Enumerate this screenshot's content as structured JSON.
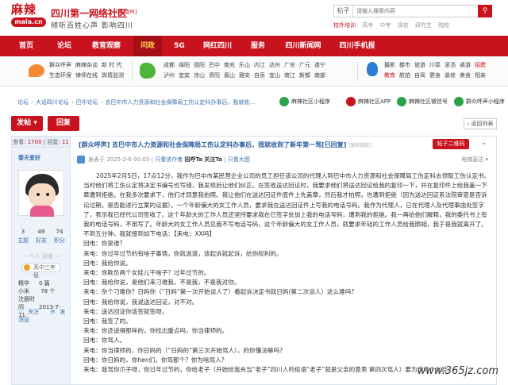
{
  "header": {
    "logo_text": "麻辣",
    "logo_sub": "mala.cn",
    "site_name": "四川第一网络社区",
    "city_tag": "[嘉南州]",
    "slogan": "倾听百姓心声 影响四川",
    "search_category": "帖子",
    "search_placeholder": "请输入搜索内容",
    "search_icon": "search-icon",
    "hot_label": "校外培训",
    "hot_links": [
      "高考",
      "中考",
      "择校",
      "研究生",
      "院校"
    ]
  },
  "nav": {
    "items": [
      "首页",
      "论坛",
      "教育观察",
      "问政",
      "5G",
      "网红四川",
      "服务",
      "四川新闻网",
      "四川手机报"
    ],
    "active_index": 3
  },
  "subnav": {
    "group1": [
      [
        "群众呼声",
        "麻辣杂谈",
        "新 时 代"
      ],
      [
        "生态环保",
        "律师在线",
        "舆情监测"
      ]
    ],
    "group2": [
      [
        "成都",
        "绵阳",
        "德阳",
        "巴中",
        "南充",
        "乐山",
        "内江",
        "达州",
        "广安",
        "广元",
        "遂宁"
      ],
      [
        "泸州",
        "宜宾",
        "凉山",
        "资阳",
        "眉山",
        "雅安",
        "自贡",
        "宜山",
        "南江",
        "新都",
        "南部"
      ]
    ],
    "group3": [
      [
        "摄影",
        "楼市",
        "旅游",
        "川菜",
        "滚汤",
        "桌游",
        "招聘"
      ],
      [
        "教育",
        "航拍",
        "自驾",
        "健身",
        "装修",
        "美食",
        "相亲"
      ]
    ],
    "highlight": [
      "招聘",
      "教育"
    ]
  },
  "breadcrumb": [
    "论坛",
    "大话四川论坛",
    "巴中论坛",
    "去巴中市人力资源和社会保障局工伤认定科办事后，我就收..."
  ],
  "mini_links": [
    "麻辣社区小程序",
    "麻辣社区APP",
    "麻辣社区微信号",
    "群众呼声小程序"
  ],
  "actions": {
    "post": "发帖",
    "reply": "回复",
    "back": "返回列表"
  },
  "author": {
    "views_label": "回复:",
    "views": "1700",
    "replies_label": "回复:",
    "replies": "11",
    "views_text": "回复: 1700",
    "stats_text": "回复: 1700 | 回复: 11",
    "name": "春天爱好",
    "counts": [
      "3",
      "49",
      "74"
    ],
    "count_labels": [
      "主题",
      "好友",
      "积分"
    ],
    "rank": "一 个人 级推 一",
    "level": "高中三年级",
    "kv": [
      [
        "精华",
        "0 篇"
      ],
      [
        "小米",
        " 78 个"
      ],
      [
        "注册时间",
        "2013-7-11"
      ]
    ],
    "ops": [
      "关注",
      "发消息"
    ]
  },
  "post": {
    "title": "[群众呼声] 去巴中市人力资源和社会保障局工伤认定科办事后，我就收到了新年第一骂[已回复]",
    "title_tag": "[复制链接]",
    "qr_label": "帖子二维码",
    "meta_prefix": "发表于 2025-2-6 00:03",
    "meta_link1": "只看该作者",
    "meta_link2": "招呼Ta",
    "meta_link3": "关注Ta",
    "meta_link4": "只看大图",
    "meta_right": "电梯直达",
    "paragraphs": [
      "2025年2月5日，17点12分，我作为巴中市某民营企业公司的员工担任该公司的代理人到巴中市人力资源和社会保障局工伤定科去领取工伤认定书。当时他们将工伤认定将决定书编号也写错，我发现后让他们纠正。在签收送达回证时，我要求他们将送达回证给我的复印一下，并在复印件上给我盖一下章遭到拒绝。在我多次要求下，他们才同意我拍照。我让他们在送达回证件底件上先盖章，然后我才拍照，也遭到拒绝（因为送达回证系法院审查是否诉讼过期，是否能进行立案的证据）。一个年龄偏大的女工作人员，要求我在送达回证件上写我的电话号码。我作为代理人，已在代理人及代理事由处签字了，表示我已经代公司签收了。这个年龄大的工作人员还坚持要求我在已签字处加上我的电话号码，遭到我的拒绝。我一再给他们解释，我的委托书上有我的电话号码，不用写了。年龄大的女工作人员见我不写电话号码，这个年龄偏大的女工作人员，就要求年轻的工作人员给我照相，我于是我就离开了。不到五分钟，我就接到如下电话：【来电：XX吗】",
      "回电：你是谁？",
      "来电：你过年过节的有啥子事情，你就说道，该起诉就起诉，给你权利的。",
      "回电：我给你说。",
      "来电：你欺负两个女娃儿干啥子？过年过节的。",
      "回电：我给你说，是他们来刁难我，不是我，不是我对你。",
      "来电：杂个刁难你？日妈你（“日妈”第一次开始谈人了）看起诉决定书就日妈(第二次谈人）这么难吗?",
      "回电：我给你说，我说送达回证，对不对。",
      "来电：送达回证你该签就签呀。",
      "回电：我签了的。",
      "来电：你还说得那样的，你找出重点吗，你当律师的。",
      "回电：你骂人。",
      "来电：你当律师的，你日妈的（“日妈的”第三次开始骂人），的你懂法嘛吗?",
      "回电：你日妈的，你hen们，你骂那个？你为啥骂人?",
      "来电：我骂你爪子呀，你过年过节的，你给老子（开始给我充当“老子”四川人的俗语“老子”就是父亲的意思 第四次骂人）要为难两个女娃"
    ]
  },
  "watermark": "www.365jz.com",
  "colors": {
    "brand_red": "#c8121d",
    "link_blue": "#3a6fb0",
    "title_blue": "#2a5d9f",
    "panel_bg": "#eef3fa"
  }
}
